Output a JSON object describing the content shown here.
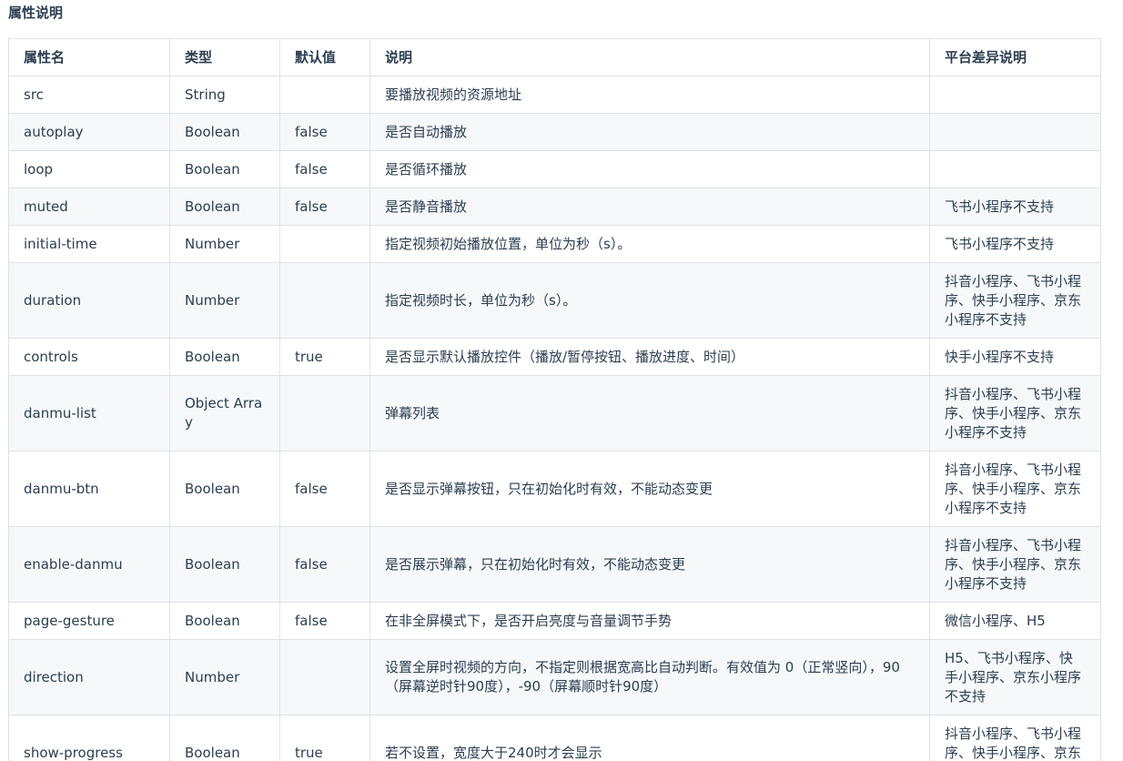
{
  "section_title": "属性说明",
  "table": {
    "headers": {
      "name": "属性名",
      "type": "类型",
      "default": "默认值",
      "desc": "说明",
      "platform": "平台差异说明"
    },
    "rows": [
      {
        "name": "src",
        "type": "String",
        "default": "",
        "desc": "要播放视频的资源地址",
        "platform": ""
      },
      {
        "name": "autoplay",
        "type": "Boolean",
        "default": "false",
        "desc": "是否自动播放",
        "platform": ""
      },
      {
        "name": "loop",
        "type": "Boolean",
        "default": "false",
        "desc": "是否循环播放",
        "platform": ""
      },
      {
        "name": "muted",
        "type": "Boolean",
        "default": "false",
        "desc": "是否静音播放",
        "platform": "飞书小程序不支持"
      },
      {
        "name": "initial-time",
        "type": "Number",
        "default": "",
        "desc": "指定视频初始播放位置，单位为秒（s）。",
        "platform": "飞书小程序不支持"
      },
      {
        "name": "duration",
        "type": "Number",
        "default": "",
        "desc": "指定视频时长，单位为秒（s）。",
        "platform": "抖音小程序、飞书小程序、快手小程序、京东小程序不支持"
      },
      {
        "name": "controls",
        "type": "Boolean",
        "default": "true",
        "desc": "是否显示默认播放控件（播放/暂停按钮、播放进度、时间）",
        "platform": "快手小程序不支持"
      },
      {
        "name": "danmu-list",
        "type": "Object Array",
        "default": "",
        "desc": "弹幕列表",
        "platform": "抖音小程序、飞书小程序、快手小程序、京东小程序不支持"
      },
      {
        "name": "danmu-btn",
        "type": "Boolean",
        "default": "false",
        "desc": "是否显示弹幕按钮，只在初始化时有效，不能动态变更",
        "platform": "抖音小程序、飞书小程序、快手小程序、京东小程序不支持"
      },
      {
        "name": "enable-danmu",
        "type": "Boolean",
        "default": "false",
        "desc": "是否展示弹幕，只在初始化时有效，不能动态变更",
        "platform": "抖音小程序、飞书小程序、快手小程序、京东小程序不支持"
      },
      {
        "name": "page-gesture",
        "type": "Boolean",
        "default": "false",
        "desc": "在非全屏模式下，是否开启亮度与音量调节手势",
        "platform": "微信小程序、H5"
      },
      {
        "name": "direction",
        "type": "Number",
        "default": "",
        "desc": "设置全屏时视频的方向，不指定则根据宽高比自动判断。有效值为 0（正常竖向），90（屏幕逆时针90度），-90（屏幕顺时针90度）",
        "platform": "H5、飞书小程序、快手小程序、京东小程序不支持"
      },
      {
        "name": "show-progress",
        "type": "Boolean",
        "default": "true",
        "desc": "若不设置，宽度大于240时才会显示",
        "platform": "抖音小程序、飞书小程序、快手小程序、京东小程序不支持"
      }
    ]
  }
}
